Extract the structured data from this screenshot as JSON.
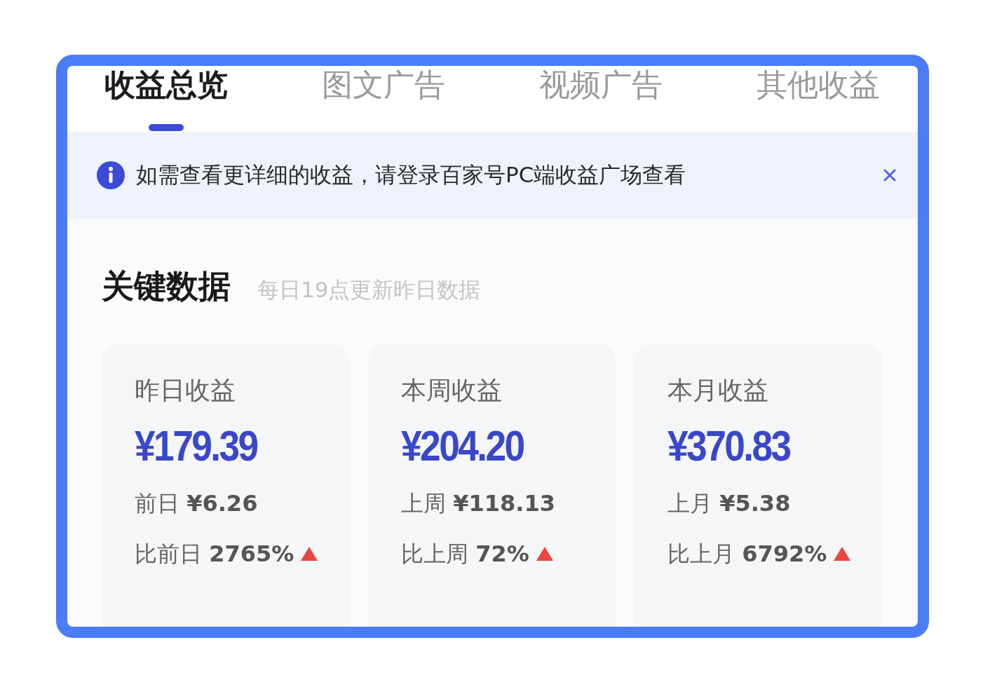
{
  "tabs": [
    {
      "label": "收益总览",
      "selected": true
    },
    {
      "label": "图文广告",
      "selected": false
    },
    {
      "label": "视频广告",
      "selected": false
    },
    {
      "label": "其他收益",
      "selected": false
    }
  ],
  "notice": {
    "text": "如需查看更详细的收益，请登录百家号PC端收益广场查看"
  },
  "section": {
    "title": "关键数据",
    "subtitle": "每日19点更新昨日数据"
  },
  "cards": [
    {
      "label": "昨日收益",
      "amount": "¥179.39",
      "previous": "前日 **¥6.26**",
      "compare": "比前日 **2765%**",
      "increase": true
    },
    {
      "label": "本周收益",
      "amount": "¥204.20",
      "previous": "上周 **¥118.13**",
      "compare": "比上周 **72%**",
      "increase": true
    },
    {
      "label": "本月收益",
      "amount": "¥370.83",
      "previous": "上月 **¥5.38**",
      "compare": "比上月 **6792%**",
      "increase": true
    }
  ]
}
